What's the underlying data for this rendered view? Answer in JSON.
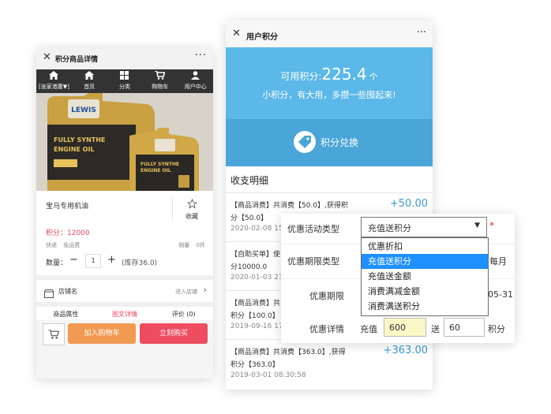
{
  "left_phone": {
    "title": "积分商品详情",
    "close_glyph": "✕",
    "more_glyph": "···",
    "nav": [
      {
        "label": "[张家港惠▼]",
        "icon": "home-icon"
      },
      {
        "label": "首页",
        "icon": "home-icon"
      },
      {
        "label": "分类",
        "icon": "grid-icon"
      },
      {
        "label": "购物车",
        "icon": "cart-icon"
      },
      {
        "label": "用户中心",
        "icon": "user-icon"
      }
    ],
    "product_brand": "LEWIS",
    "product_text": "FULLY SYNTHE ENGINE OIL",
    "product_name": "宝马专用机油",
    "favorite_label": "收藏",
    "points_price": "积分：12000",
    "shipping_label": "快递",
    "shipping_value": "免运费",
    "sales_label": "销量",
    "sales_value": "0件",
    "quantity_label": "数量：",
    "quantity_value": "1",
    "stock_text": "(库存36.0)",
    "store_label": "店铺名",
    "enter_store": "进入店铺",
    "tabs": [
      "商品属性",
      "图文详情",
      "评价 (0)"
    ],
    "add_to_cart": "加入购物车",
    "buy_now": "立刻购买"
  },
  "mid_phone": {
    "title": "用户积分",
    "close_glyph": "✕",
    "more_glyph": "···",
    "available_label": "可用积分:",
    "available_value": "225.4",
    "available_unit": "个",
    "slogan": "小积分，有大用，多攒一些囤起来!",
    "exchange_label": "积分兑换",
    "section_title": "收支明细",
    "records": [
      {
        "line1": "【商品消费】共消费【50.0】,获得积",
        "line2": "分【50.0】",
        "date": "2020-02-08 15",
        "amount": "+50.00"
      },
      {
        "line1": "【自助买单】使",
        "line2": "分10000.0",
        "date": "2020-01-03 23",
        "amount": ""
      },
      {
        "line1": "【商品消费】共",
        "line2": "积分【100.0】",
        "date": "2019-09-16 17",
        "amount": ""
      },
      {
        "line1": "【商品消费】共消费【363.0】,获得",
        "line2": "积分【363.0】",
        "date": "2019-03-01 08:30:58",
        "amount": "+363.00"
      }
    ]
  },
  "form": {
    "type_label": "优惠活动类型",
    "type_value": "充值送积分",
    "required_mark": "*",
    "options": [
      "优惠折扣",
      "充值送积分",
      "充值送金额",
      "消费满减金额",
      "消费满送积分"
    ],
    "selected_index": 1,
    "period_type_label": "优惠期限类型",
    "period_type_tail": "每月",
    "period_label": "优惠期限",
    "period_tail": "05-31",
    "detail_label": "优惠详情",
    "recharge_label": "充值",
    "recharge_value": "600",
    "give_label": "送",
    "give_value": "60",
    "points_unit": "积分"
  },
  "colors": {
    "accent_blue": "#5bb8e8",
    "amount_blue": "#3a9ad9",
    "price_red": "#e8455a",
    "cart_orange": "#f39a52",
    "buy_red": "#ee4c5f",
    "selected_option": "#1e90ff",
    "highlight_input": "#fbf7c7"
  }
}
